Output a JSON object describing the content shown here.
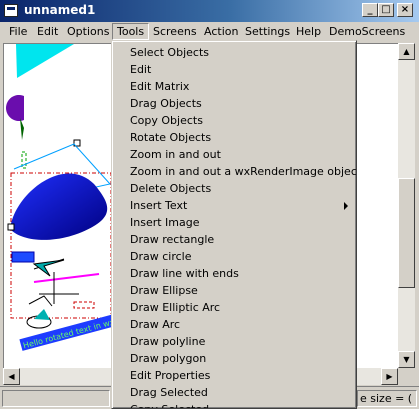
{
  "window": {
    "title": "unnamed1"
  },
  "title_buttons": {
    "minimize": "_",
    "maximize": "□",
    "close": "×"
  },
  "menubar": [
    "File",
    "Edit",
    "Options",
    "Tools",
    "Screens",
    "Action",
    "Settings",
    "Help",
    "DemoScreens"
  ],
  "tools_menu": {
    "items": [
      "Select Objects",
      "Edit",
      "Edit Matrix",
      "Drag Objects",
      "Copy Objects",
      "Rotate Objects",
      "Zoom in and out",
      "Zoom in and out a wxRenderImage object",
      "Delete Objects",
      "Insert Text",
      "Insert Image",
      "Draw rectangle",
      "Draw circle",
      "Draw line with ends",
      "Draw Ellipse",
      "Draw Elliptic Arc",
      "Draw Arc",
      "Draw polyline",
      "Draw polygon",
      "Edit Properties",
      "Drag Selected",
      "Copy Selected"
    ],
    "submenu_item": "Insert Text"
  },
  "canvas": {
    "rotated_text": "Hello rotated text in wxCanvas"
  },
  "statusbar": {
    "right_text": "e size = ("
  },
  "colors": {
    "accent": "#0a246a",
    "cyan": "#00e5ee",
    "blue": "#0000cd",
    "purple": "#6a0dad",
    "magenta": "#ff00ff"
  }
}
